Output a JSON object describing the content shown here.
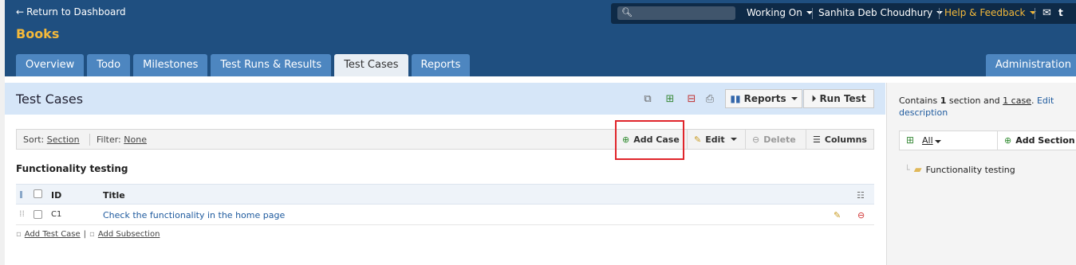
{
  "header": {
    "return_link": "Return to Dashboard",
    "project_title": "Books",
    "search_placeholder": "",
    "working_on": "Working On",
    "user_name": "Sanhita Deb Choudhury",
    "help": "Help & Feedback",
    "help_color": "#f4b93a"
  },
  "tabs": [
    {
      "label": "Overview"
    },
    {
      "label": "Todo"
    },
    {
      "label": "Milestones"
    },
    {
      "label": "Test Runs & Results"
    },
    {
      "label": "Test Cases",
      "active": true
    },
    {
      "label": "Reports"
    }
  ],
  "admin_tab": "Administration",
  "page": {
    "title": "Test Cases",
    "reports_button": "Reports",
    "run_test_button": "Run Test"
  },
  "toolbar": {
    "sort_label": "Sort:",
    "sort_value": "Section",
    "filter_label": "Filter:",
    "filter_value": "None",
    "add_case": "Add Case",
    "edit": "Edit",
    "delete": "Delete",
    "columns": "Columns"
  },
  "section": {
    "heading": "Functionality testing",
    "columns": {
      "id": "ID",
      "title": "Title"
    },
    "rows": [
      {
        "id": "C1",
        "title": "Check the functionality in the home page"
      }
    ],
    "add_test_case": "Add Test Case",
    "add_subsection": "Add Subsection"
  },
  "sidebar": {
    "desc_prefix": "Contains",
    "section_count": "1",
    "section_word": "section and",
    "case_link": "1 case",
    "edit_description": "Edit description",
    "filter_all": "All",
    "add_section": "Add Section",
    "tree_item": "Functionality testing"
  }
}
